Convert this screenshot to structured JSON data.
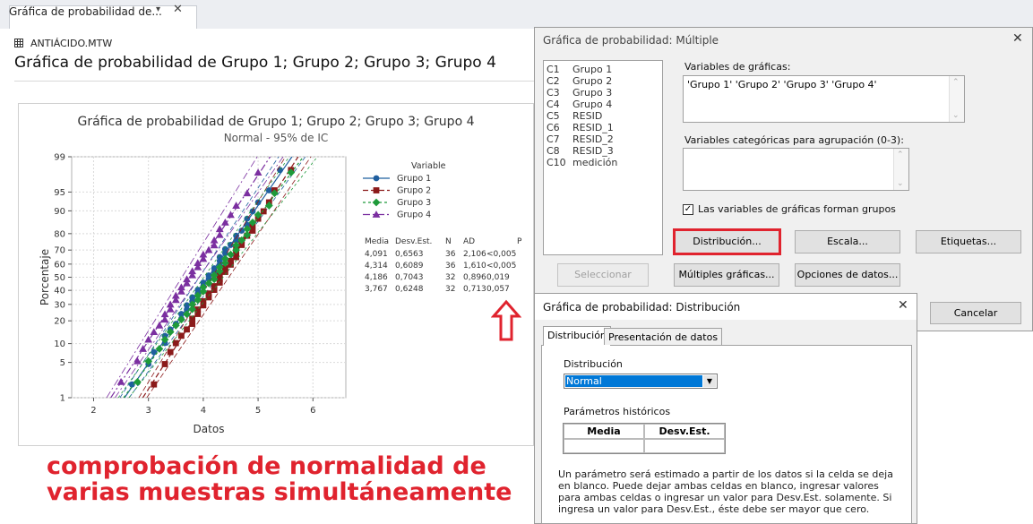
{
  "tab": {
    "title": "Gráfica de probabilidad de...",
    "chevron": "▾",
    "close": "✕"
  },
  "worksheet": {
    "file": "ANTIÁCIDO.MTW",
    "title": "Gráfica de probabilidad de Grupo 1; Grupo 2; Grupo 3; Grupo 4"
  },
  "chart_data": {
    "type": "scatter",
    "title": "Gráfica de probabilidad de Grupo 1; Grupo 2; Grupo 3; Grupo 4",
    "subtitle": "Normal - 95% de IC",
    "xlabel": "Datos",
    "ylabel": "Porcentaje",
    "xlim": [
      1.6,
      6.6
    ],
    "x_ticks": [
      2,
      3,
      4,
      5,
      6
    ],
    "y_ticks": [
      1,
      5,
      10,
      20,
      30,
      40,
      50,
      60,
      70,
      80,
      90,
      95,
      99
    ],
    "y_scale": "normal-probability",
    "ylim": [
      1,
      99
    ],
    "grid": true,
    "legend_title": "Variable",
    "legend_position": "right",
    "series": [
      {
        "name": "Grupo 1",
        "color": "#1f5f9f",
        "marker": "circle",
        "mean": 4.091,
        "sd": 0.6563,
        "n": 36
      },
      {
        "name": "Grupo 2",
        "color": "#8b1a1a",
        "marker": "square",
        "mean": 4.314,
        "sd": 0.6089,
        "n": 36
      },
      {
        "name": "Grupo 3",
        "color": "#1e9a3a",
        "marker": "diamond",
        "mean": 4.186,
        "sd": 0.7043,
        "n": 32
      },
      {
        "name": "Grupo 4",
        "color": "#7b2fa0",
        "marker": "triangle",
        "mean": 3.767,
        "sd": 0.6248,
        "n": 32
      }
    ],
    "stats_table": {
      "headers": [
        "Media",
        "Desv.Est.",
        "N",
        "AD",
        "P"
      ],
      "rows": [
        [
          "4,091",
          "0,6563",
          "36",
          "2,106",
          "<0,005"
        ],
        [
          "4,314",
          "0,6089",
          "36",
          "1,610",
          "<0,005"
        ],
        [
          "4,186",
          "0,7043",
          "32",
          "0,896",
          "0,019"
        ],
        [
          "3,767",
          "0,6248",
          "32",
          "0,713",
          "0,057"
        ]
      ]
    }
  },
  "annotation": {
    "line1": "comprobación de normalidad de",
    "line2": "varias muestras simultáneamente",
    "arrow_color": "#e0232e"
  },
  "dialog_multiple": {
    "title": "Gráfica de probabilidad: Múltiple",
    "close": "✕",
    "columns": [
      [
        "C1",
        "Grupo 1"
      ],
      [
        "C2",
        "Grupo 2"
      ],
      [
        "C3",
        "Grupo 3"
      ],
      [
        "C4",
        "Grupo 4"
      ],
      [
        "C5",
        "RESID"
      ],
      [
        "C6",
        "RESID_1"
      ],
      [
        "C7",
        "RESID_2"
      ],
      [
        "C8",
        "RESID_3"
      ],
      [
        "C10",
        "medición"
      ]
    ],
    "graph_vars_label": "Variables de gráficas:",
    "graph_vars_value": "'Grupo 1' 'Grupo 2' 'Grupo 3' 'Grupo 4'",
    "cat_vars_label": "Variables categóricas para agrupación (0-3):",
    "cat_vars_value": "",
    "groups_checkbox_label": "Las variables de gráficas forman grupos",
    "groups_checked": "✓",
    "buttons": {
      "distribucion": "Distribución...",
      "escala": "Escala...",
      "etiquetas": "Etiquetas...",
      "seleccionar": "Seleccionar",
      "multiples": "Múltiples gráficas...",
      "opciones": "Opciones de datos...",
      "cancelar": "Cancelar"
    }
  },
  "dialog_distribution": {
    "title": "Gráfica de probabilidad: Distribución",
    "close": "✕",
    "tabs": [
      "Distribución",
      "Presentación de datos"
    ],
    "dist_label": "Distribución",
    "dist_value": "Normal",
    "hist_label": "Parámetros históricos",
    "param_headers": [
      "Media",
      "Desv.Est."
    ],
    "help_text": "Un parámetro será estimado a partir de los datos si la celda se deja en blanco. Puede dejar ambas celdas en blanco, ingresar valores para ambas celdas o ingresar un valor para Desv.Est. solamente. Si ingresa un valor para Desv.Est., éste debe ser mayor que cero."
  }
}
